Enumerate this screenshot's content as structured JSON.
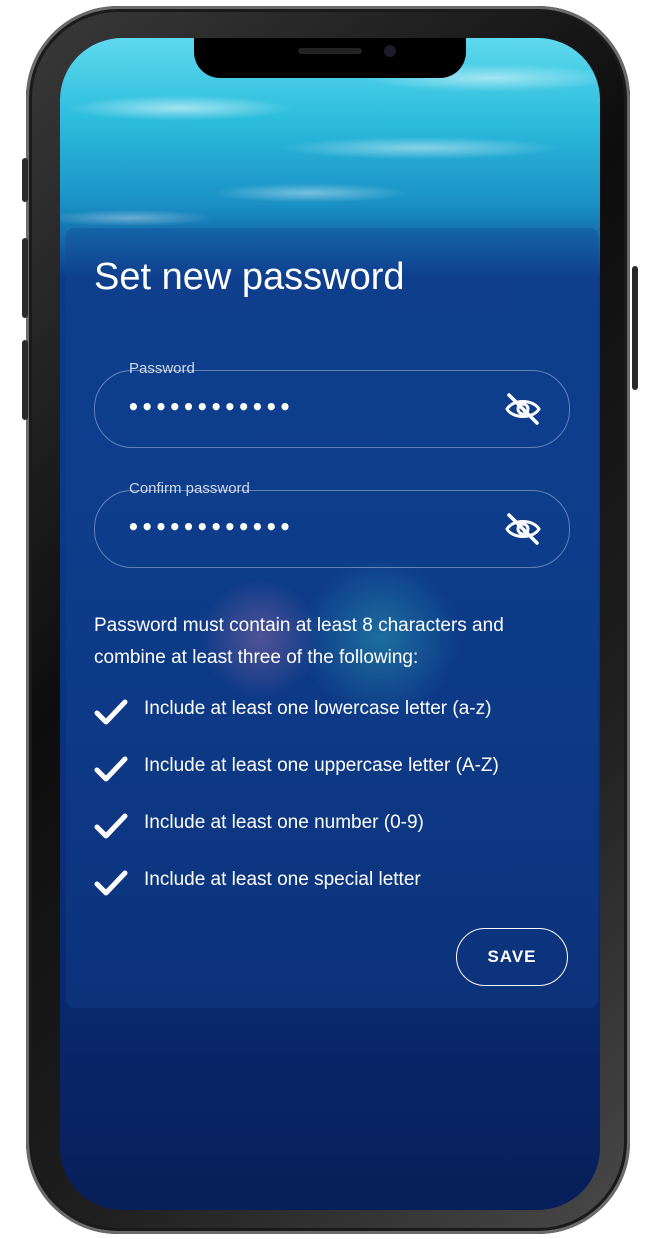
{
  "screen": {
    "title": "Set new password"
  },
  "password_field": {
    "label": "Password",
    "value": "••••••••••••",
    "toggle_icon": "eye-off-icon"
  },
  "confirm_field": {
    "label": "Confirm password",
    "value": "••••••••••••",
    "toggle_icon": "eye-off-icon"
  },
  "requirements": {
    "intro": "Password must contain at least 8 characters and combine at least three of the following:",
    "items": [
      {
        "label": "Include at least one lowercase letter (a-z)",
        "icon": "check-icon"
      },
      {
        "label": "Include at least one uppercase letter (A-Z)",
        "icon": "check-icon"
      },
      {
        "label": "Include at least one number (0-9)",
        "icon": "check-icon"
      },
      {
        "label": "Include at least one special letter",
        "icon": "check-icon"
      }
    ]
  },
  "actions": {
    "save_label": "SAVE"
  },
  "colors": {
    "text": "#ffffff",
    "background_top": "#5fd9ee",
    "background_bottom": "#071f5a"
  }
}
